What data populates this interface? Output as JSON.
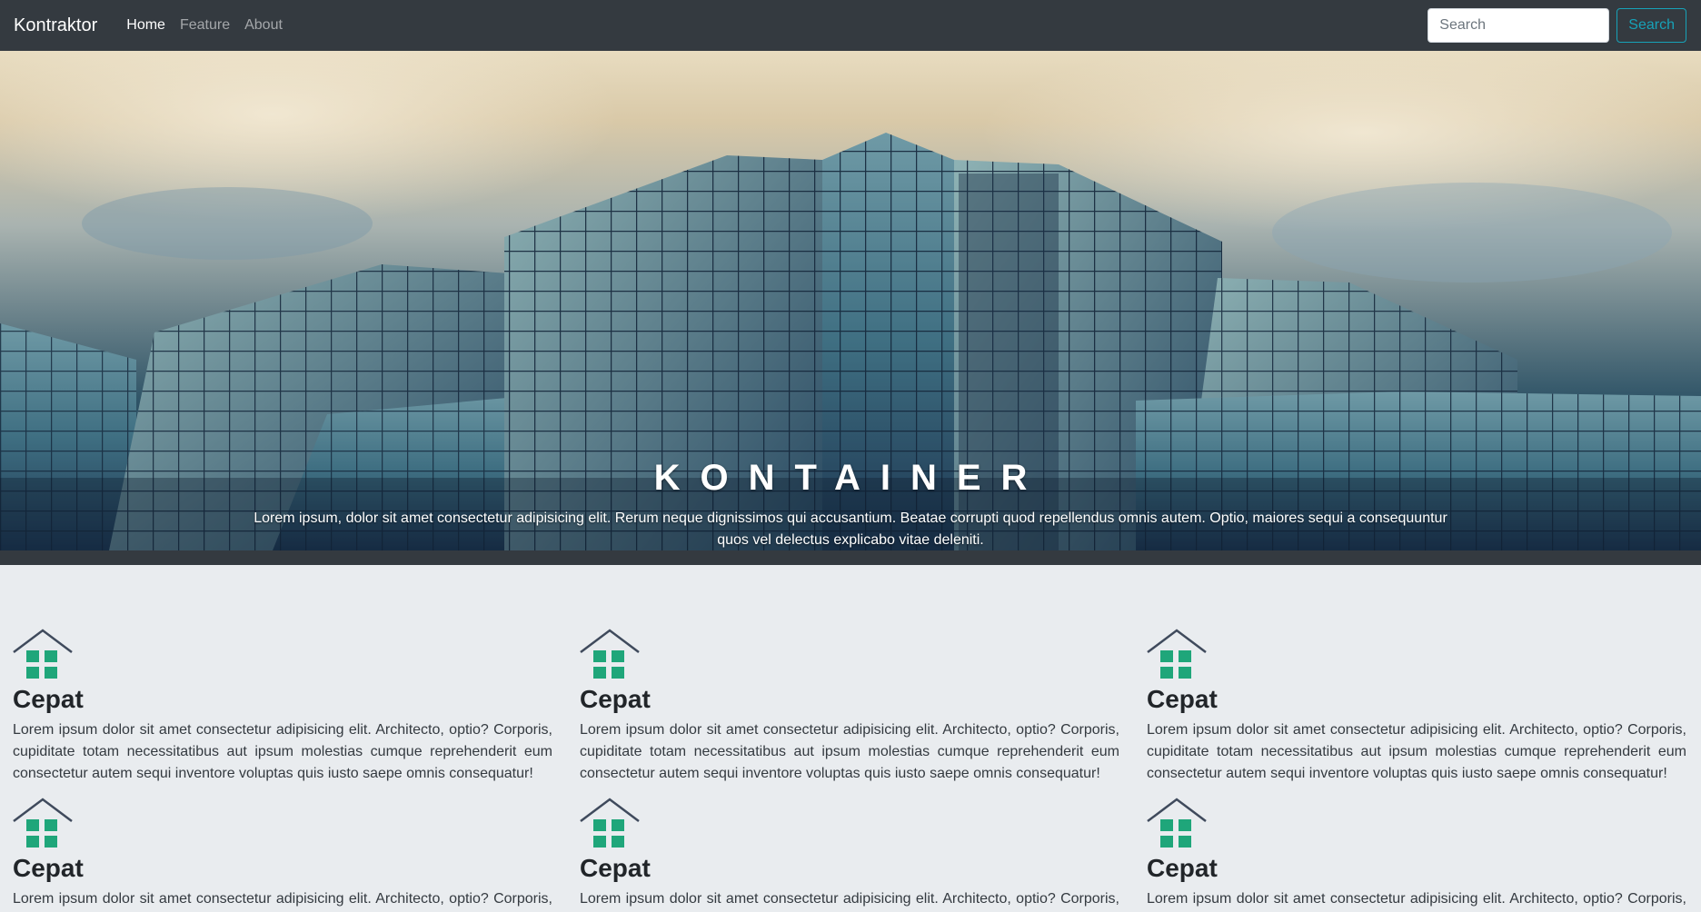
{
  "navbar": {
    "brand": "Kontraktor",
    "links": [
      {
        "label": "Home",
        "active": true
      },
      {
        "label": "Feature",
        "active": false
      },
      {
        "label": "About",
        "active": false
      }
    ],
    "search": {
      "placeholder": "Search",
      "button_label": "Search"
    }
  },
  "hero": {
    "title": "KONTAINER",
    "text": "Lorem ipsum, dolor sit amet consectetur adipisicing elit. Rerum neque dignissimos qui accusantium. Beatae corrupti quod repellendus omnis autem. Optio, maiores sequi a consequuntur quos vel delectus explicabo vitae deleniti."
  },
  "features": [
    {
      "icon": "house-icon",
      "title": "Cepat",
      "text": "Lorem ipsum dolor sit amet consectetur adipisicing elit. Architecto, optio? Corporis, cupiditate totam necessitatibus aut ipsum molestias cumque reprehenderit eum consectetur autem sequi inventore voluptas quis iusto saepe omnis consequatur!"
    },
    {
      "icon": "house-icon",
      "title": "Cepat",
      "text": "Lorem ipsum dolor sit amet consectetur adipisicing elit. Architecto, optio? Corporis, cupiditate totam necessitatibus aut ipsum molestias cumque reprehenderit eum consectetur autem sequi inventore voluptas quis iusto saepe omnis consequatur!"
    },
    {
      "icon": "house-icon",
      "title": "Cepat",
      "text": "Lorem ipsum dolor sit amet consectetur adipisicing elit. Architecto, optio? Corporis, cupiditate totam necessitatibus aut ipsum molestias cumque reprehenderit eum consectetur autem sequi inventore voluptas quis iusto saepe omnis consequatur!"
    },
    {
      "icon": "house-icon",
      "title": "Cepat",
      "text": "Lorem ipsum dolor sit amet consectetur adipisicing elit. Architecto, optio? Corporis, cupiditate totam necessitatibus aut ipsum molestias cumque reprehenderit eum consectetur autem sequi inventore voluptas quis iusto saepe omnis consequatur!"
    },
    {
      "icon": "house-icon",
      "title": "Cepat",
      "text": "Lorem ipsum dolor sit amet consectetur adipisicing elit. Architecto, optio? Corporis, cupiditate totam necessitatibus aut ipsum molestias cumque reprehenderit eum consectetur autem sequi inventore voluptas quis iusto saepe omnis consequatur!"
    },
    {
      "icon": "house-icon",
      "title": "Cepat",
      "text": "Lorem ipsum dolor sit amet consectetur adipisicing elit. Architecto, optio? Corporis, cupiditate totam necessitatibus aut ipsum molestias cumque reprehenderit eum consectetur autem sequi inventore voluptas quis iusto saepe omnis consequatur!"
    }
  ],
  "colors": {
    "navbar_bg": "#343a40",
    "accent": "#17a2b8",
    "icon_green": "#1fa67a",
    "icon_roof": "#3f4a5c",
    "page_bg": "#e9ecef"
  }
}
